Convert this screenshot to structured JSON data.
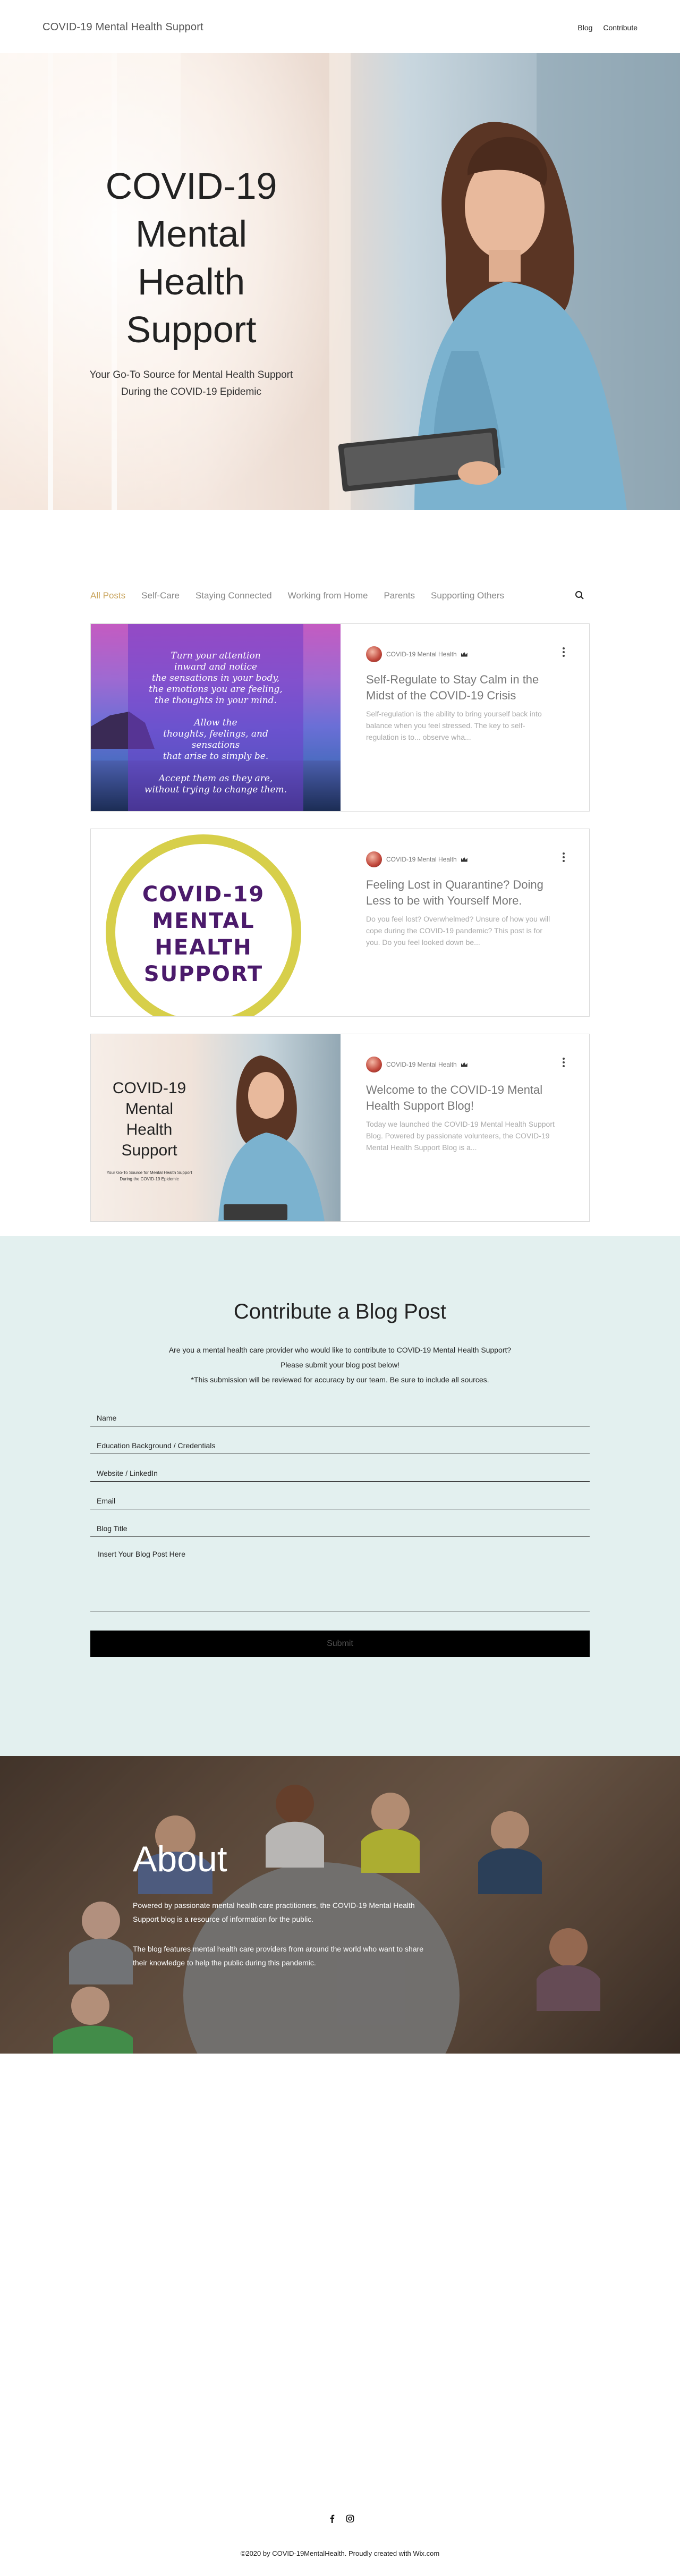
{
  "header": {
    "site_title": "COVID-19 Mental Health Support",
    "nav": [
      "Blog",
      "Contribute"
    ]
  },
  "hero": {
    "title": "COVID-19 Mental Health Support",
    "subtitle": "Your Go-To Source for Mental Health Support During the COVID-19 Epidemic"
  },
  "blog": {
    "categories": [
      "All Posts",
      "Self-Care",
      "Staying Connected",
      "Working from Home",
      "Parents",
      "Supporting Others"
    ],
    "active_category": "All Posts",
    "posts": [
      {
        "author": "COVID-19 Mental Health",
        "title": "Self-Regulate to Stay Calm in the Midst of the COVID-19 Crisis",
        "excerpt": "Self-regulation is the ability to bring yourself back into balance when you feel stressed. The key to self-regulation is to... observe wha...",
        "image_text": "Turn your attention\ninward and notice\nthe sensations in your body,\nthe emotions you are feeling,\nthe thoughts in your mind.\n\nAllow the\nthoughts, feelings, and sensations\nthat arise to simply be.\n\nAccept them as they are,\nwithout trying to change them."
      },
      {
        "author": "COVID-19 Mental Health",
        "title": "Feeling Lost in Quarantine? Doing Less to be with Yourself More.",
        "excerpt": "Do you feel lost? Overwhelmed? Unsure of how you will cope during the COVID-19 pandemic? This post is for you. Do you feel looked down be...",
        "image_text": "COVID-19 MENTAL HEALTH SUPPORT"
      },
      {
        "author": "COVID-19 Mental Health",
        "title": "Welcome to the COVID-19 Mental Health Support Blog!",
        "excerpt": "Today we launched the COVID-19 Mental Health Support Blog. Powered by passionate volunteers, the COVID-19 Mental Health Support Blog is a...",
        "image_title": "COVID-19 Mental Health Support",
        "image_sub": "Your Go-To Source for Mental Health Support During the COVID-19 Epidemic"
      }
    ]
  },
  "contribute": {
    "heading": "Contribute a Blog Post",
    "intro_1": "Are you a mental health care provider who would like to contribute to COVID-19 Mental Health Support?",
    "intro_2": "Please submit your blog post below!",
    "intro_3": "*This submission will be reviewed for accuracy by our team. Be sure to include all sources.",
    "fields": [
      "Name",
      "Education Background / Credentials",
      "Website / LinkedIn",
      "Email",
      "Blog Title"
    ],
    "textarea_placeholder": "Insert Your Blog Post Here",
    "submit_label": "Submit"
  },
  "about": {
    "heading": "About",
    "paragraph_1": "Powered by passionate mental health care practitioners, the COVID-19 Mental Health Support blog is a resource of information for the public.",
    "paragraph_2": "The blog features mental health care providers from around the world who want to share their knowledge to help the public during this pandemic."
  },
  "footer": {
    "social_icons": [
      "facebook-icon",
      "instagram-icon"
    ],
    "copyright": "©2020 by COVID-19MentalHealth. Proudly created with Wix.com"
  },
  "colors": {
    "active_category": "#c9a45c",
    "contribute_bg": "#e3f0ef",
    "logo_purple": "#4b1a6b",
    "logo_ring": "#d7cf4a"
  }
}
